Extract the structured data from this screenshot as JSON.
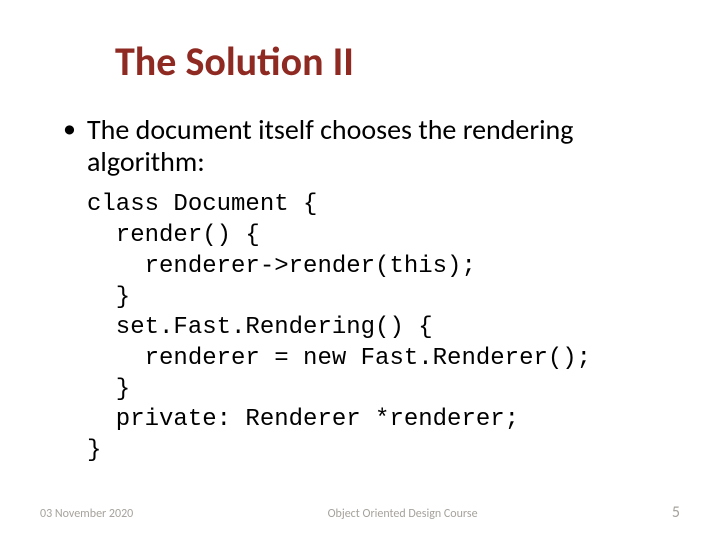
{
  "title": "The Solution II",
  "bullet": "The document itself chooses the rendering algorithm:",
  "code": "class Document {\n  render() {\n    renderer->render(this);\n  }\n  set.Fast.Rendering() {\n    renderer = new Fast.Renderer();\n  }\n  private: Renderer *renderer;\n}",
  "footer": {
    "date": "03 November 2020",
    "course": "Object Oriented Design Course",
    "page": "5"
  }
}
